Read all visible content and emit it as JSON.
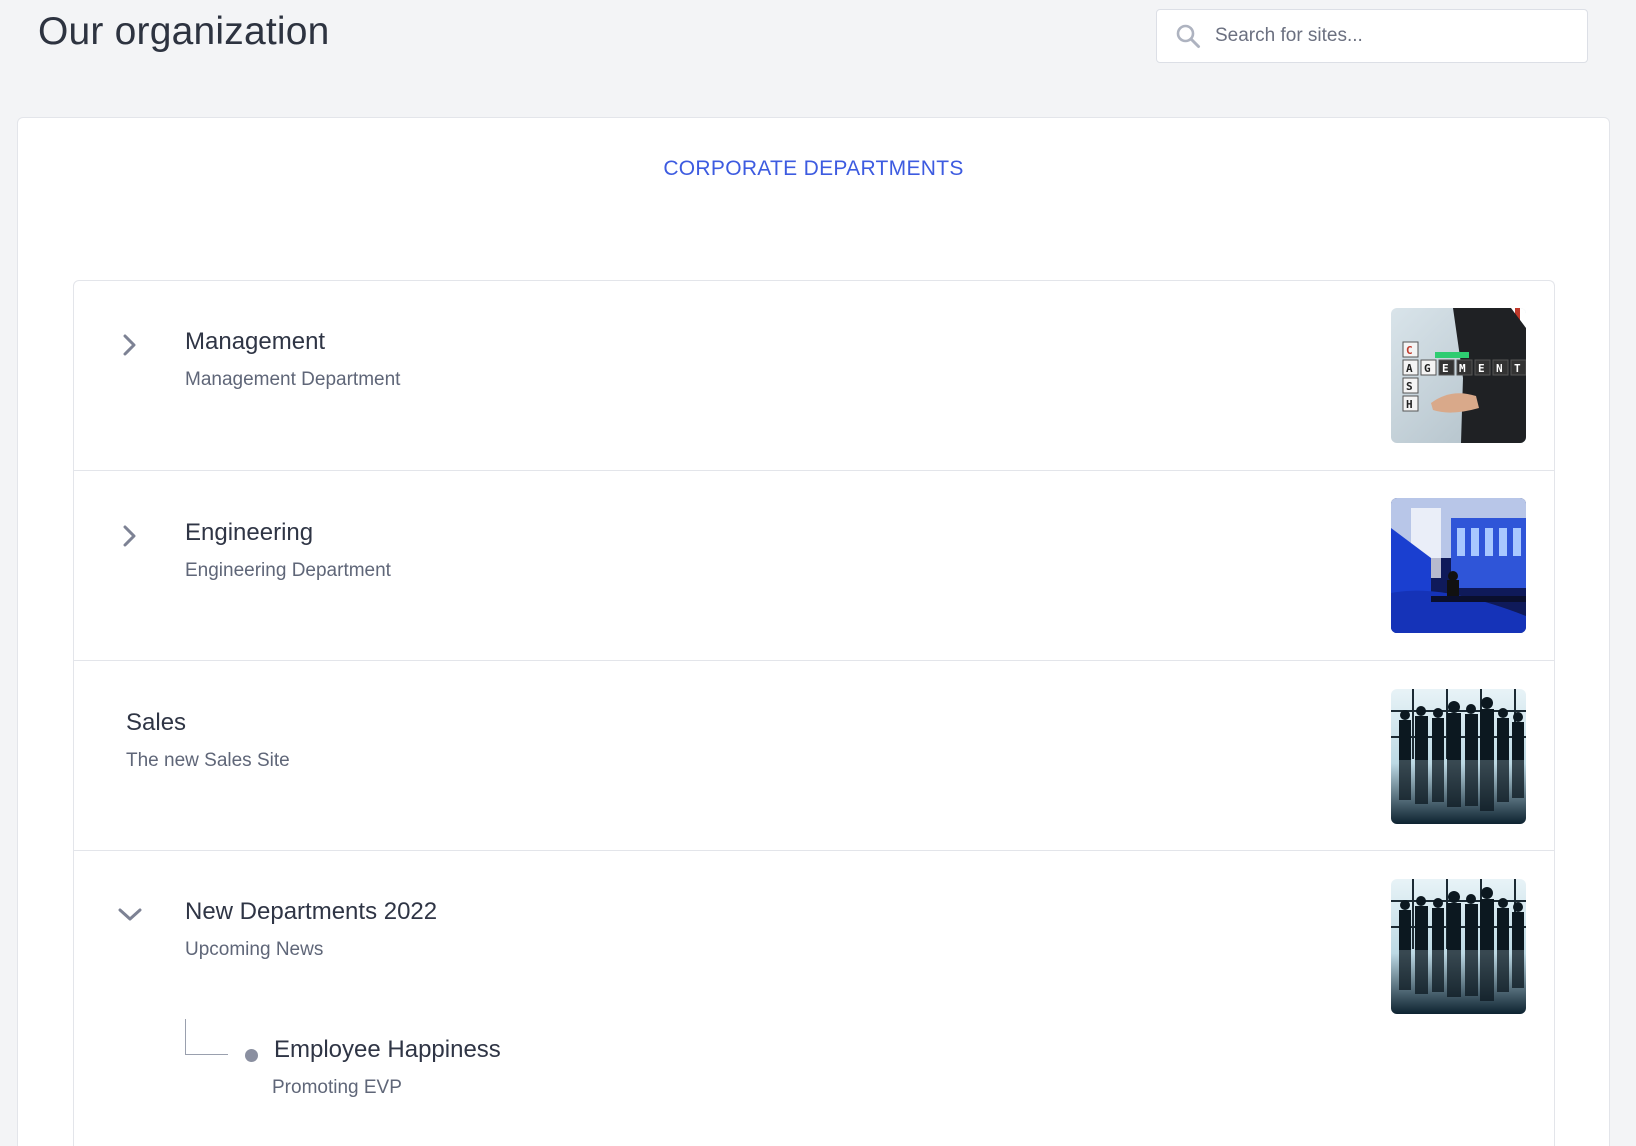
{
  "header": {
    "title": "Our organization",
    "search_placeholder": "Search for sites..."
  },
  "section": {
    "heading": "CORPORATE DEPARTMENTS"
  },
  "departments": [
    {
      "title": "Management",
      "subtitle": "Management Department",
      "expander": "chevron-right-icon",
      "image": "management-thumbnail"
    },
    {
      "title": "Engineering",
      "subtitle": "Engineering Department",
      "expander": "chevron-right-icon",
      "image": "engineering-thumbnail"
    },
    {
      "title": "Sales",
      "subtitle": "The new Sales Site",
      "expander": "none",
      "image": "team-silhouette-thumbnail"
    },
    {
      "title": "New Departments 2022",
      "subtitle": "Upcoming News",
      "expander": "chevron-down-icon",
      "image": "team-silhouette-thumbnail",
      "children": [
        {
          "title": "Employee Happiness",
          "subtitle": "Promoting EVP"
        }
      ]
    }
  ],
  "colors": {
    "accent": "#3d5be0",
    "background": "#f3f4f6",
    "card": "#ffffff",
    "muted_text": "#5f6678",
    "icon": "#8a8fa0"
  }
}
